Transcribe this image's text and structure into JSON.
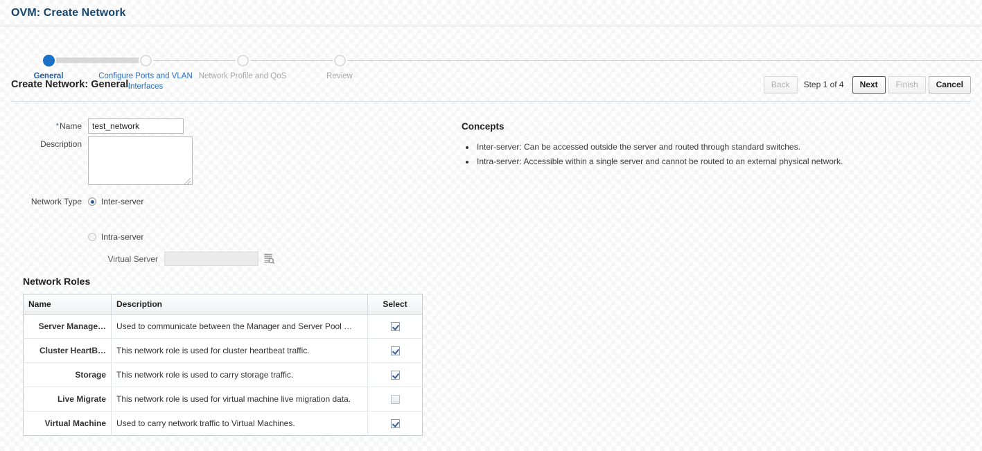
{
  "page": {
    "title": "OVM: Create Network"
  },
  "train": {
    "steps": [
      {
        "label": "General",
        "state": "current"
      },
      {
        "label": "Configure Ports and VLAN Interfaces",
        "state": "link"
      },
      {
        "label": "Network Profile and QoS",
        "state": "disabled"
      },
      {
        "label": "Review",
        "state": "disabled"
      }
    ]
  },
  "subheader": {
    "title": "Create Network: General",
    "back_label": "Back",
    "step_counter": "Step 1 of 4",
    "next_label": "Next",
    "finish_label": "Finish",
    "cancel_label": "Cancel"
  },
  "form": {
    "name_label": "Name",
    "name_required_marker": "*",
    "name_value": "test_network",
    "name_placeholder": "",
    "description_label": "Description",
    "description_value": "",
    "description_placeholder": "",
    "network_type_label": "Network Type",
    "inter_server_label": "Inter-server",
    "intra_server_label": "Intra-server",
    "virtual_server_label": "Virtual Server",
    "virtual_server_value": "",
    "virtual_server_placeholder": "",
    "lookup_icon": "search-list-icon"
  },
  "concepts": {
    "title": "Concepts",
    "items": [
      "Inter-server: Can be accessed outside the server and routed through standard switches.",
      "Intra-server: Accessible within a single server and cannot be routed to an external physical network."
    ]
  },
  "network_roles": {
    "title": "Network Roles",
    "columns": [
      "Name",
      "Description",
      "Select"
    ],
    "rows": [
      {
        "name": "Server Manage…",
        "description": "Used to communicate between the Manager and Server Pool …",
        "selected": true
      },
      {
        "name": "Cluster HeartB…",
        "description": "This network role is used for cluster heartbeat traffic.",
        "selected": true
      },
      {
        "name": "Storage",
        "description": "This network role is used to carry storage traffic.",
        "selected": true
      },
      {
        "name": "Live Migrate",
        "description": "This network role is used for virtual machine live migration data.",
        "selected": false
      },
      {
        "name": "Virtual Machine",
        "description": "Used to carry network traffic to Virtual Machines.",
        "selected": true
      }
    ]
  },
  "colors": {
    "title_blue": "#14446b",
    "link_blue": "#2a6ebb",
    "active_step": "#1a73c8",
    "required_star": "#3070c0",
    "check_blue": "#3b5c96"
  }
}
